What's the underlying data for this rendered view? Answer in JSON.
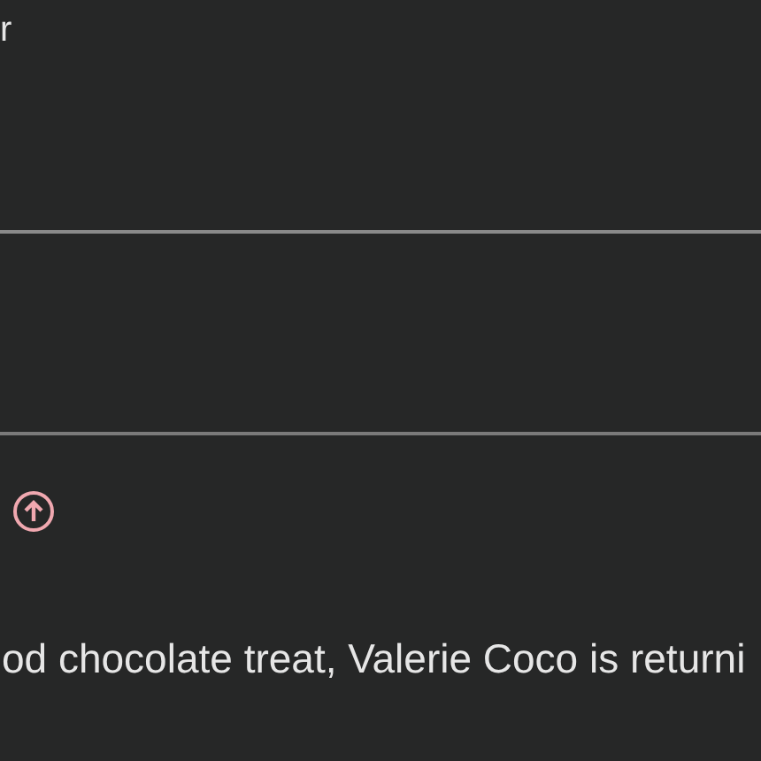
{
  "header_text": "r",
  "body_text": "od chocolate treat, Valerie Coco is returni"
}
